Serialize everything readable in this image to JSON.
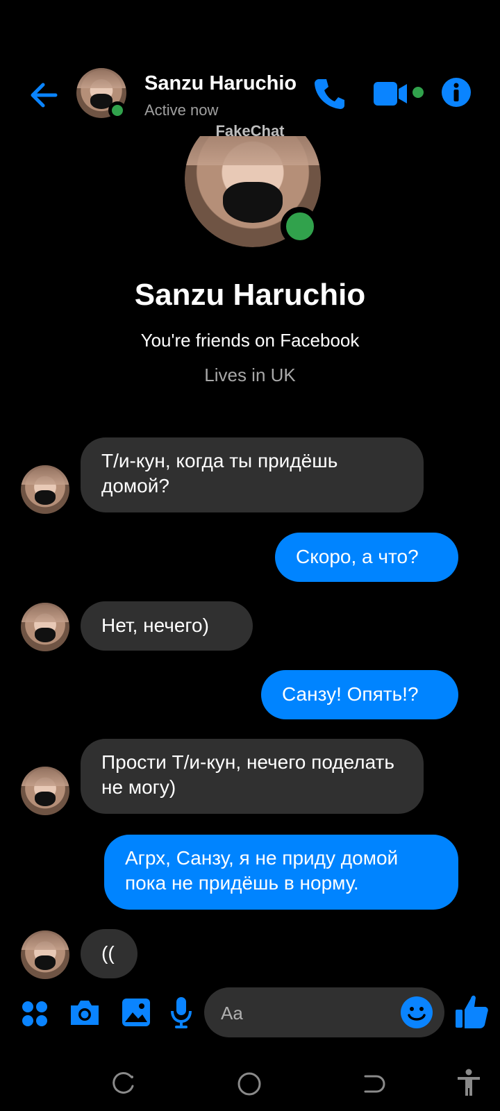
{
  "header": {
    "contact_name": "Sanzu Haruchio",
    "status": "Active now"
  },
  "watermark": "FakeChat",
  "profile": {
    "name": "Sanzu Haruchio",
    "friends_line": "You're friends on Facebook",
    "location": "Lives in UK"
  },
  "messages": [
    {
      "from": "contact",
      "text": "Т/и-кун, когда ты придёшь домой?"
    },
    {
      "from": "me",
      "text": "Скоро, а что?"
    },
    {
      "from": "contact",
      "text": "Нет, нечего)"
    },
    {
      "from": "me",
      "text": "Санзу! Опять!?"
    },
    {
      "from": "contact",
      "text": "Прости Т/и-кун, нечего поделать не могу)"
    },
    {
      "from": "me",
      "text": "Агрх, Санзу, я не приду домой пока не придёшь в норму."
    },
    {
      "from": "contact",
      "text": "(("
    }
  ],
  "composer": {
    "placeholder": "Aa"
  },
  "colors": {
    "accent": "#0084ff",
    "online": "#31a24c",
    "incoming_bubble": "#303030",
    "background": "#000000"
  },
  "icons": {
    "header": [
      "back-arrow-icon",
      "phone-icon",
      "video-icon",
      "info-icon"
    ],
    "composer": [
      "menu-dots-icon",
      "camera-icon",
      "image-icon",
      "microphone-icon",
      "emoji-icon",
      "like-icon"
    ],
    "navbar": [
      "recents-icon",
      "home-icon",
      "back-icon",
      "accessibility-icon"
    ]
  }
}
